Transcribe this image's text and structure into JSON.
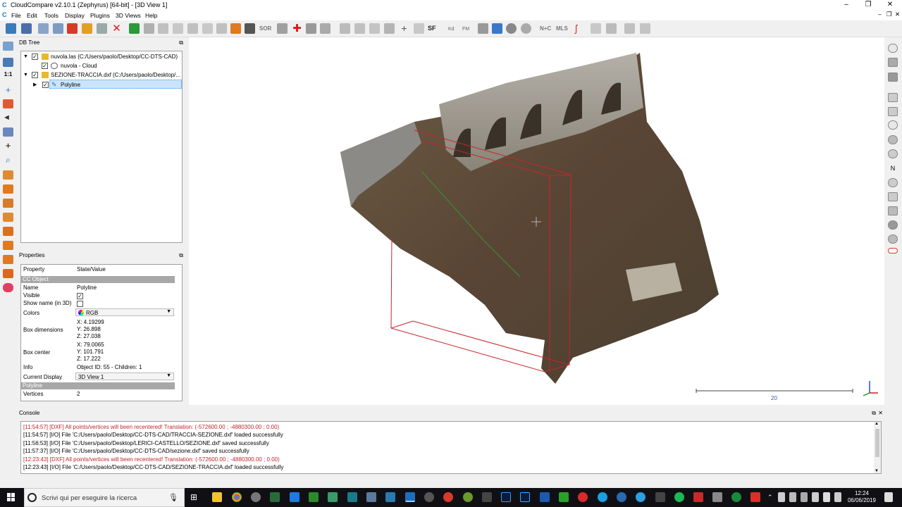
{
  "window": {
    "title": "CloudCompare v2.10.1 (Zephyrus) [64-bit] - [3D View 1]"
  },
  "menu": [
    "File",
    "Edit",
    "Tools",
    "Display",
    "Plugins",
    "3D Views",
    "Help"
  ],
  "toolbar_text": {
    "sf": "SF",
    "sor": "SOR",
    "kd": "Kd",
    "fm": "FM",
    "nc": "N+C",
    "mls": "MLS",
    "lefttb_ratio": "1:1"
  },
  "db_tree": {
    "title": "DB Tree",
    "items": [
      {
        "label": "nuvola.las (C:/Users/paolo/Desktop/CC-DTS-CAD)",
        "checked": true
      },
      {
        "label": "nuvola - Cloud",
        "checked": true
      },
      {
        "label": "SEZIONE-TRACCIA.dxf (C:/Users/paolo/Desktop/...",
        "checked": true
      },
      {
        "label": "Polyline",
        "checked": true
      }
    ]
  },
  "properties": {
    "title": "Properties",
    "col_property": "Property",
    "col_value": "State/Value",
    "section_cc": "CC Object",
    "name_k": "Name",
    "name_v": "Polyline",
    "visible_k": "Visible",
    "visible_checked": true,
    "showname_k": "Show name (in 3D)",
    "showname_checked": false,
    "colors_k": "Colors",
    "colors_v": "RGB",
    "boxdim_k": "Box dimensions",
    "boxdim_x": "X: 4.19299",
    "boxdim_y": "Y: 26.898",
    "boxdim_z": "Z: 27.038",
    "boxcenter_k": "Box center",
    "boxcenter_x": "X: 79.0065",
    "boxcenter_y": "Y: 101.791",
    "boxcenter_z": "Z: 17.222",
    "info_k": "Info",
    "info_v": "Object ID: 55 - Children: 1",
    "display_k": "Current Display",
    "display_v": "3D View 1",
    "section_poly": "Polyline",
    "vertices_k": "Vertices",
    "vertices_v": "2"
  },
  "view3d": {
    "scale_label": "20"
  },
  "console": {
    "title": "Console",
    "lines": [
      {
        "text": "[11:54:57] [DXF] All points/vertices will been recentered! Translation: (-572600.00 ; -4880300.00 ; 0.00)",
        "color": "#c0262d"
      },
      {
        "text": "[11:54:57] [I/O] File 'C:/Users/paolo/Desktop/CC-DTS-CAD/TRACCIA-SEZIONE.dxf' loaded successfully",
        "color": "#000000"
      },
      {
        "text": "[11:56:53] [I/O] File 'C:/Users/paolo/Desktop/LERICI-CASTELLO/SEZIONE.dxf' saved successfully",
        "color": "#000000"
      },
      {
        "text": "[11:57:37] [I/O] File 'C:/Users/paolo/Desktop/CC-DTS-CAD/sezione.dxf' saved successfully",
        "color": "#000000"
      },
      {
        "text": "[12:23:43] [DXF] All points/vertices will been recentered! Translation: (-572600.00 ; -4880300.00 ; 0.00)",
        "color": "#c0262d"
      },
      {
        "text": "[12:23:43] [I/O] File 'C:/Users/paolo/Desktop/CC-DTS-CAD/SEZIONE-TRACCIA.dxf' loaded successfully",
        "color": "#000000"
      }
    ]
  },
  "taskbar": {
    "search_placeholder": "Scrivi qui per eseguire la ricerca",
    "time": "12:24",
    "date": "06/06/2019"
  },
  "colors": {
    "accent": "#1d6fbd",
    "selection": "#cce4f7",
    "error_text": "#c0262d",
    "section_bg": "#a8a8a8"
  }
}
